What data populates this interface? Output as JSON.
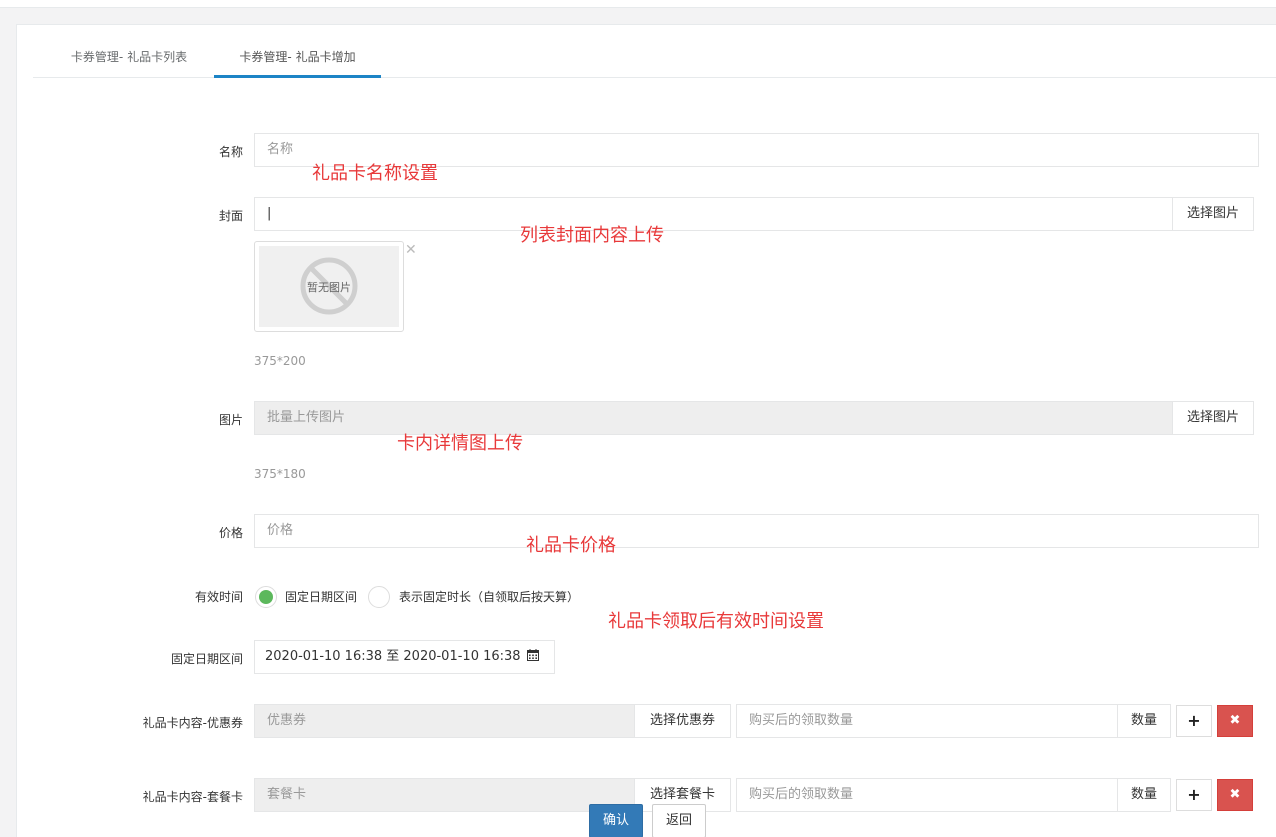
{
  "tabs": [
    {
      "label": "卡券管理- 礼品卡列表"
    },
    {
      "label": "卡券管理- 礼品卡增加"
    }
  ],
  "form": {
    "name": {
      "label": "名称",
      "placeholder": "名称",
      "note": "礼品卡名称设置"
    },
    "cover": {
      "label": "封面",
      "value": "|",
      "button": "选择图片",
      "note": "列表封面内容上传",
      "no_image_text": "暂无图片",
      "size_hint": "375*200"
    },
    "images": {
      "label": "图片",
      "placeholder": "批量上传图片",
      "button": "选择图片",
      "note": "卡内详情图上传",
      "size_hint": "375*180"
    },
    "price": {
      "label": "价格",
      "placeholder": "价格",
      "note": "礼品卡价格"
    },
    "valid_time": {
      "label": "有效时间",
      "options": [
        {
          "label": "固定日期区间",
          "selected": true
        },
        {
          "label": "表示固定时长（自领取后按天算）",
          "selected": false
        }
      ],
      "note": "礼品卡领取后有效时间设置"
    },
    "fixed_range": {
      "label": "固定日期区间",
      "value": "2020-01-10 16:38 至 2020-01-10 16:38",
      "icon": "calendar-icon"
    },
    "coupon": {
      "label": "礼品卡内容-优惠券",
      "placeholder": "优惠券",
      "select_button": "选择优惠券",
      "qty_placeholder": "购买后的领取数量",
      "qty_label": "数量",
      "add": "+",
      "remove": "✖"
    },
    "package": {
      "label": "礼品卡内容-套餐卡",
      "placeholder": "套餐卡",
      "select_button": "选择套餐卡",
      "qty_placeholder": "购买后的领取数量",
      "qty_label": "数量",
      "add": "+",
      "remove": "✖"
    }
  },
  "actions": {
    "confirm": "确认",
    "back": "返回"
  },
  "colors": {
    "accent": "#1c84c6",
    "note": "#e8393a",
    "success": "#5cb85c",
    "danger": "#d9534f",
    "primary": "#337ab7"
  }
}
